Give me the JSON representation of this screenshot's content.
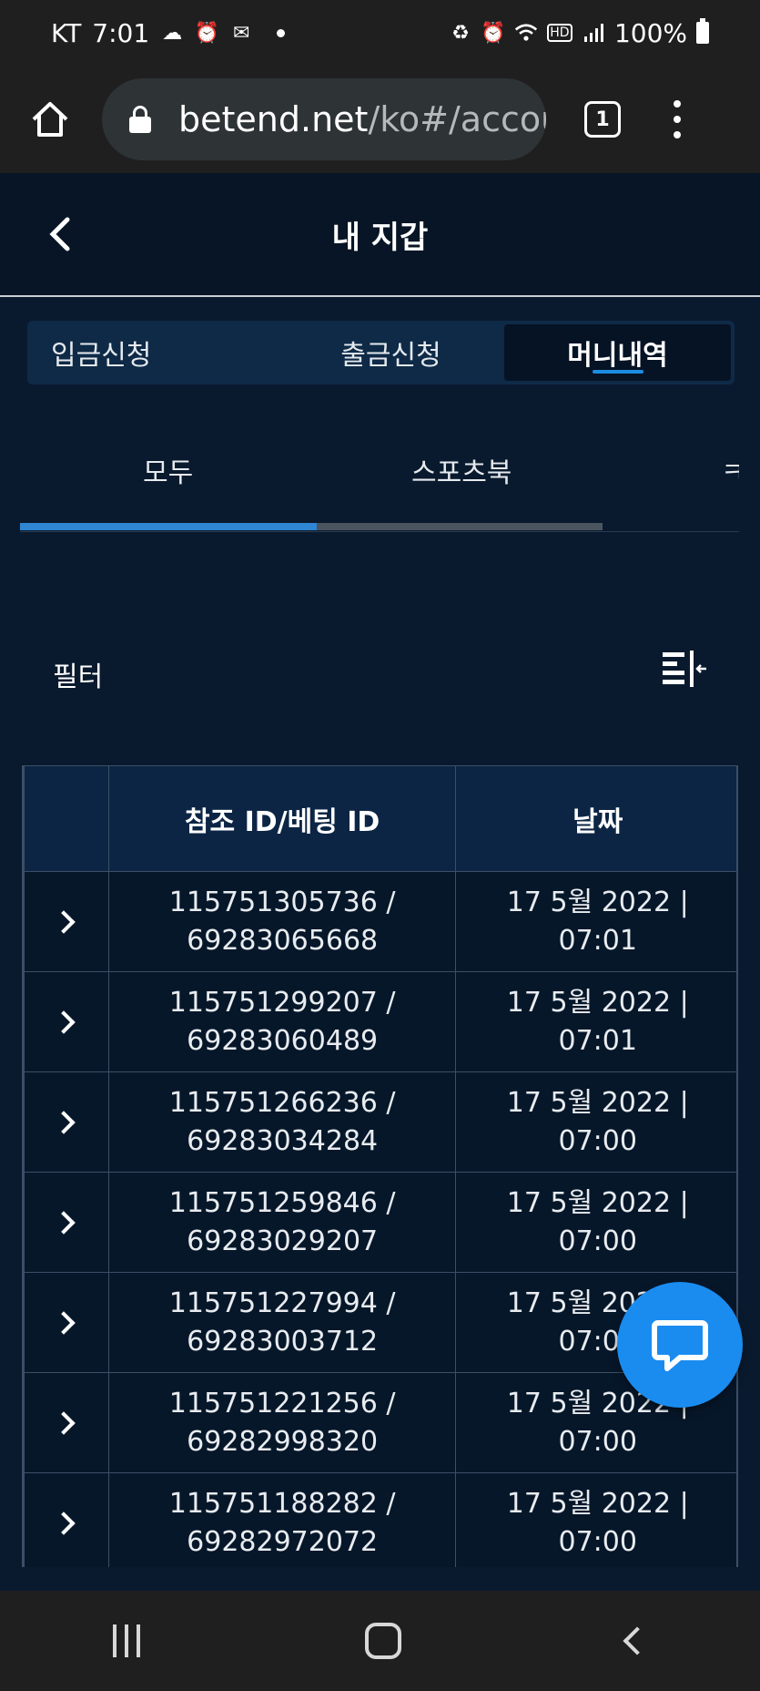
{
  "statusbar": {
    "carrier": "KT",
    "time": "7:01",
    "battery": "100%"
  },
  "browser": {
    "url_main": "betend.net",
    "url_rest": "/ko#/accou",
    "tab_count": "1"
  },
  "header": {
    "title": "내 지갑"
  },
  "segment_tabs": [
    {
      "label": "입금신청"
    },
    {
      "label": "출금신청"
    },
    {
      "label": "머니내역"
    }
  ],
  "sub_tabs": [
    {
      "label": "모두"
    },
    {
      "label": "스포츠북"
    },
    {
      "label": "ㅋ"
    }
  ],
  "filter": {
    "label": "필터"
  },
  "table": {
    "headers": [
      "",
      "참조 ID/베팅 ID",
      "날짜"
    ],
    "rows": [
      {
        "ref": "115751305736 /",
        "bet": "69283065668",
        "date": "17 5월 2022 |",
        "time": "07:01"
      },
      {
        "ref": "115751299207 /",
        "bet": "69283060489",
        "date": "17 5월 2022 |",
        "time": "07:01"
      },
      {
        "ref": "115751266236 /",
        "bet": "69283034284",
        "date": "17 5월 2022 |",
        "time": "07:00"
      },
      {
        "ref": "115751259846 /",
        "bet": "69283029207",
        "date": "17 5월 2022 |",
        "time": "07:00"
      },
      {
        "ref": "115751227994 /",
        "bet": "69283003712",
        "date": "17 5월 2022 |",
        "time": "07:00"
      },
      {
        "ref": "115751221256 /",
        "bet": "69282998320",
        "date": "17 5월 2022 |",
        "time": "07:00"
      },
      {
        "ref": "115751188282 /",
        "bet": "69282972072",
        "date": "17 5월 2022 |",
        "time": "07:00"
      }
    ]
  },
  "colors": {
    "accent": "#1b8de0",
    "chat_fab": "#1a8cf0",
    "background": "#0a1a2e"
  }
}
